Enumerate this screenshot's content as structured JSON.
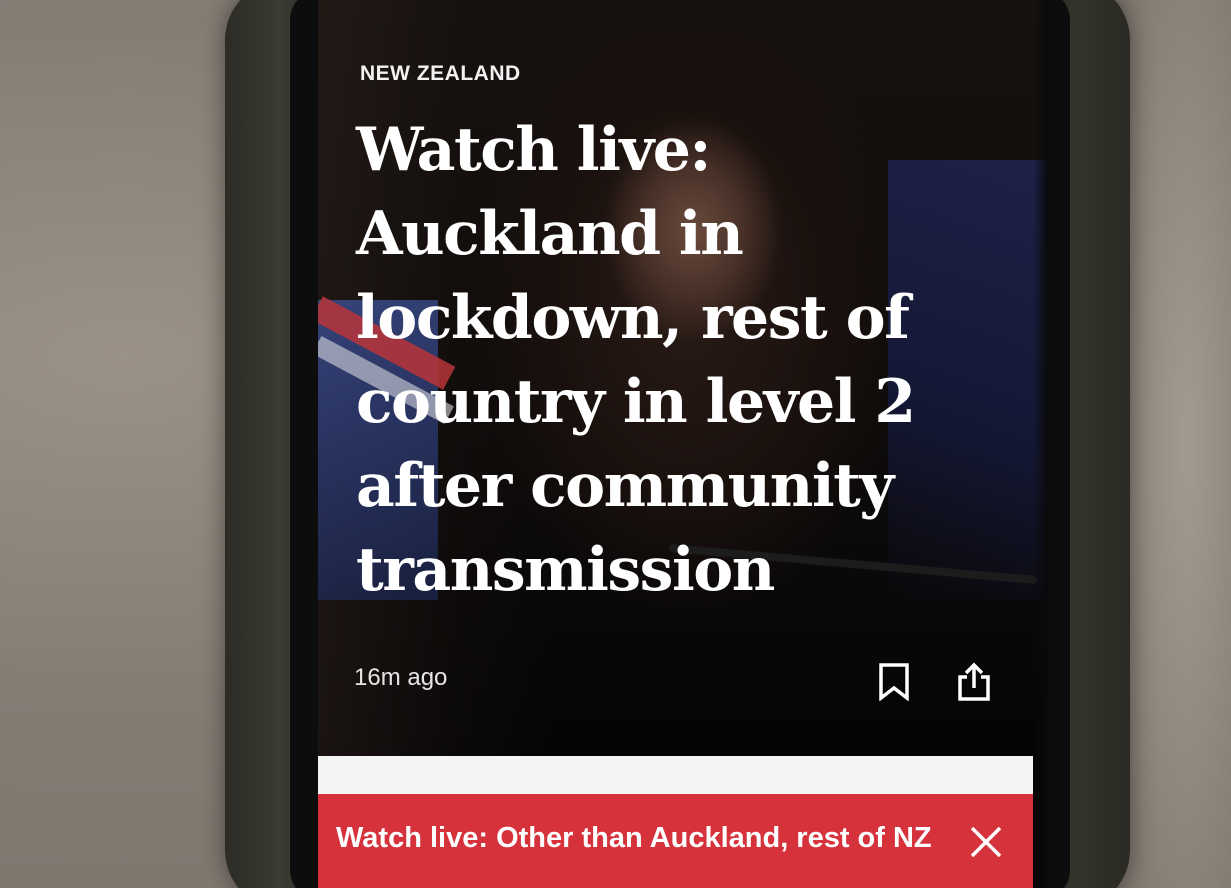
{
  "article": {
    "category": "NEW ZEALAND",
    "headline": "Watch live: Auckland in lockdown, rest of country in level 2 after community transmission",
    "timestamp": "16m ago"
  },
  "actions": {
    "bookmark_icon": "bookmark-icon",
    "share_icon": "share-icon"
  },
  "live_banner": {
    "text": "Watch live: Other than Auckland, rest of NZ",
    "close_icon": "close-icon",
    "color": "#d6323b"
  }
}
